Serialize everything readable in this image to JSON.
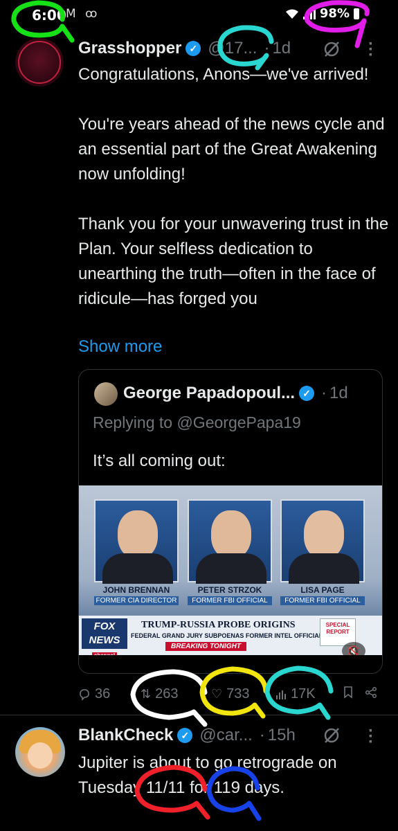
{
  "status_bar": {
    "time": "6:00",
    "left_icons": "M ꝏ",
    "battery": "98%"
  },
  "tweet": {
    "author_name": "Grasshopper",
    "handle": "@17...",
    "separator": "·",
    "time": "1d",
    "body_paragraphs": [
      "Congratulations, Anons—we've arrived!",
      "You're years ahead of the news cycle and an essential part of the Great Awakening now unfolding!",
      "Thank you for your unwavering trust in the Plan. Your selfless dedication to unearthing the truth—often in the face of ridicule—has forged you"
    ],
    "show_more": "Show more",
    "quote": {
      "author_name": "George Papadopoul...",
      "separator": "·",
      "time": "1d",
      "replying_to": "Replying to @GeorgePapa19",
      "text": "It’s all coming out:",
      "media": {
        "people": [
          {
            "name": "JOHN BRENNAN",
            "title": "FORMER CIA DIRECTOR"
          },
          {
            "name": "PETER STRZOK",
            "title": "FORMER FBI OFFICIAL"
          },
          {
            "name": "LISA PAGE",
            "title": "FORMER FBI OFFICIAL"
          }
        ],
        "logo_text": "FOX NEWS",
        "logo_sub": "channel",
        "headline": "TRUMP-RUSSIA PROBE ORIGINS",
        "subheadline": "FEDERAL GRAND JURY SUBPOENAS FORMER INTEL OFFICIALS",
        "breaking": "BREAKING TONIGHT",
        "special_report": "SPECIAL REPORT"
      }
    },
    "actions": {
      "replies": "36",
      "reposts": "263",
      "likes": "733",
      "views": "17K"
    }
  },
  "tweet2": {
    "author_name": "BlankCheck",
    "handle": "@car...",
    "separator": "·",
    "time": "15h",
    "body": "Jupiter is about to go retrograde on Tuesday 11/11 for 119 days."
  },
  "colors": {
    "accent": "#1d9bf0",
    "muted": "#71767b",
    "annotation_green": "#16e016",
    "annotation_magenta": "#e11de8",
    "annotation_cyan": "#2ad6d0",
    "annotation_white": "#ffffff",
    "annotation_yellow": "#f2e40d",
    "annotation_red": "#f0202a",
    "annotation_blue": "#1742e8"
  }
}
